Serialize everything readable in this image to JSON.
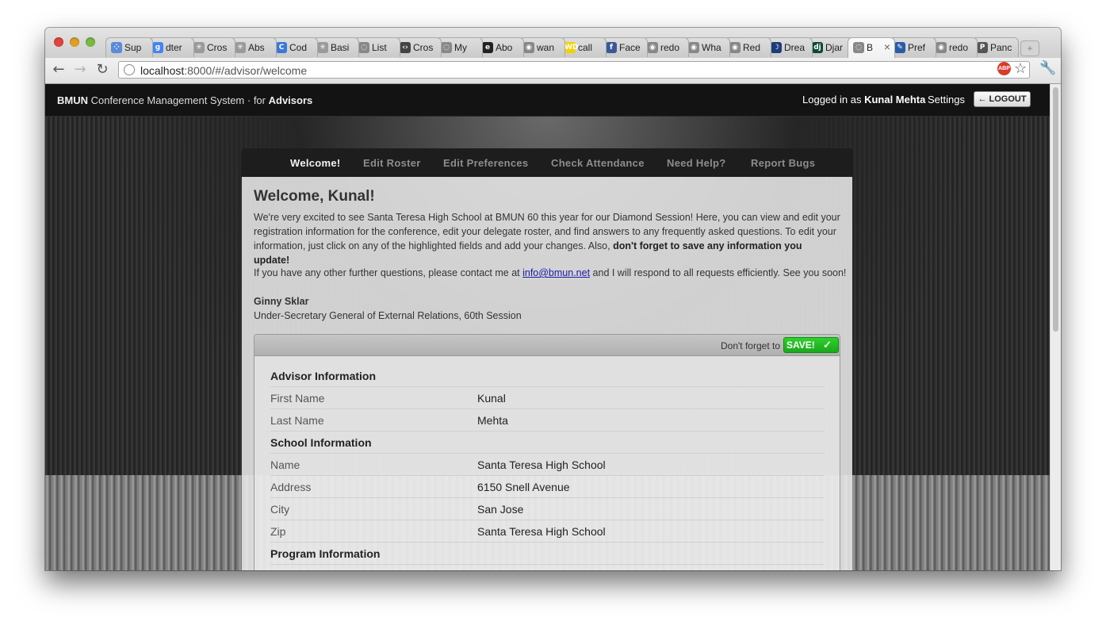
{
  "browser": {
    "tabs": [
      {
        "label": "Sup",
        "icon": "apps-icon",
        "color": "#5b8bd9"
      },
      {
        "label": "dter",
        "icon": "google-icon",
        "color": "#4285f4"
      },
      {
        "label": "Cros",
        "icon": "asterisk-icon",
        "color": "#9a9a9a"
      },
      {
        "label": "Abs",
        "icon": "asterisk-icon",
        "color": "#9a9a9a"
      },
      {
        "label": "Cod",
        "icon": "c-icon",
        "color": "#3b78d8"
      },
      {
        "label": "Basi",
        "icon": "asterisk-icon",
        "color": "#9a9a9a"
      },
      {
        "label": "List",
        "icon": "globe-icon",
        "color": "#888888"
      },
      {
        "label": "Cros",
        "icon": "code-icon",
        "color": "#444444"
      },
      {
        "label": "My",
        "icon": "globe-icon",
        "color": "#888888"
      },
      {
        "label": "Abo",
        "icon": "e-icon",
        "color": "#222222"
      },
      {
        "label": "wan",
        "icon": "reddit-icon",
        "color": "#888888"
      },
      {
        "label": "call",
        "icon": "wd-icon",
        "color": "#f2d200"
      },
      {
        "label": "Face",
        "icon": "facebook-icon",
        "color": "#3b5998"
      },
      {
        "label": "redo",
        "icon": "reddit-icon",
        "color": "#888888"
      },
      {
        "label": "Wha",
        "icon": "reddit-icon",
        "color": "#888888"
      },
      {
        "label": "Red",
        "icon": "reddit-icon",
        "color": "#888888"
      },
      {
        "label": "Drea",
        "icon": "moon-icon",
        "color": "#1d3c78"
      },
      {
        "label": "Djar",
        "icon": "django-icon",
        "color": "#0c4b33"
      },
      {
        "label": "B",
        "icon": "globe-icon",
        "color": "#888888",
        "active": true
      },
      {
        "label": "Pref",
        "icon": "wrench-icon",
        "color": "#2a5ba8"
      },
      {
        "label": "redo",
        "icon": "reddit-icon",
        "color": "#888888"
      },
      {
        "label": "Panc",
        "icon": "p-icon",
        "color": "#555555"
      }
    ],
    "url_host": "localhost",
    "url_path": ":8000/#/advisor/welcome",
    "adblock_label": "ABP"
  },
  "topbar": {
    "brand_prefix": "BMUN",
    "brand_rest": " Conference Management System · for ",
    "brand_role": "Advisors",
    "logged_in_prefix": "Logged in as ",
    "user_name": "Kunal Mehta",
    "settings": "Settings",
    "logout": "← LOGOUT"
  },
  "nav": {
    "items": [
      "Welcome!",
      "Edit Roster",
      "Edit Preferences",
      "Check Attendance",
      "Need Help?",
      "Report Bugs"
    ],
    "active_index": 0
  },
  "welcome": {
    "heading": "Welcome, Kunal!",
    "intro": "We're very excited to see Santa Teresa High School at BMUN 60 this year for our Diamond Session! Here, you can view and edit your registration information for the conference, edit your delegate roster, and find answers to any frequently asked questions. To edit your information, just click on any of the highlighted fields and add your changes. Also, ",
    "intro_bold": "don't forget to save any information you update!",
    "contact_prefix": "If you have any other further questions, please contact me at ",
    "contact_email": "info@bmun.net",
    "contact_suffix": " and I will respond to all requests efficiently. See you soon!",
    "signature_name": "Ginny Sklar",
    "signature_title": "Under-Secretary General of External Relations, 60th Session"
  },
  "form": {
    "reminder": "Don't forget to",
    "save_label": "SAVE!",
    "sections": [
      {
        "title": "Advisor Information",
        "fields": [
          {
            "label": "First Name",
            "value": "Kunal"
          },
          {
            "label": "Last Name",
            "value": "Mehta"
          }
        ]
      },
      {
        "title": "School Information",
        "fields": [
          {
            "label": "Name",
            "value": "Santa Teresa High School"
          },
          {
            "label": "Address",
            "value": "6150 Snell Avenue"
          },
          {
            "label": "City",
            "value": "San Jose"
          },
          {
            "label": "Zip",
            "value": "Santa Teresa High School"
          }
        ]
      },
      {
        "title": "Program Information",
        "fields": []
      }
    ]
  }
}
